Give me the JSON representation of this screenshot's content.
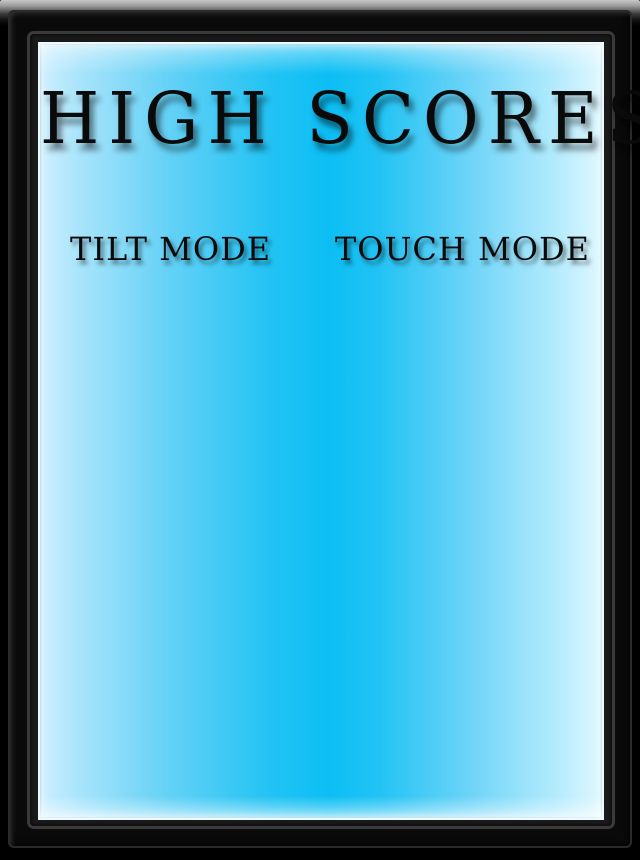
{
  "screen": {
    "title": "HIGH SCORES"
  },
  "tabs": [
    {
      "label": "TILT MODE"
    },
    {
      "label": "TOUCH MODE"
    }
  ],
  "colors": {
    "panel_center": "#0cbef4",
    "panel_edge": "#e3f8ff",
    "frame": "#000000",
    "text": "#0a0a0a"
  }
}
